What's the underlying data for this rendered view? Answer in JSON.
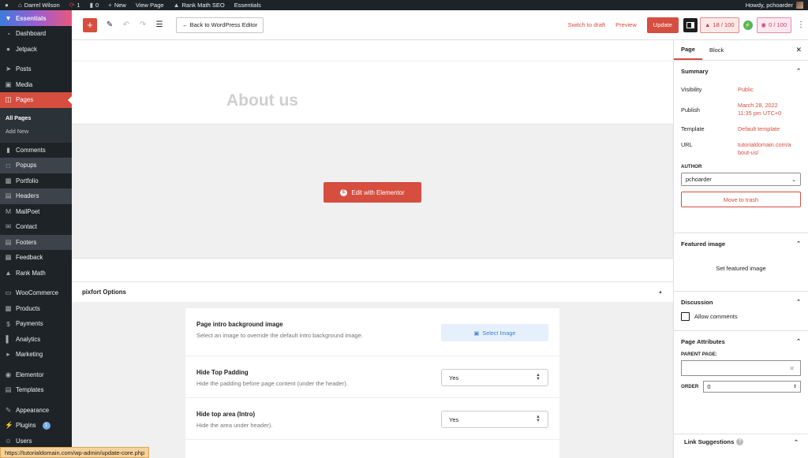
{
  "admin_bar": {
    "site_name": "Darrel Wilson",
    "updates_count": "1",
    "comments_count": "0",
    "new_label": "New",
    "view_page_label": "View Page",
    "rank_math_label": "Rank Math SEO",
    "essentials_label": "Essentials",
    "howdy_label": "Howdy, pchoarder"
  },
  "sidebar": {
    "items": [
      {
        "label": "Essentials",
        "icon": "essentials-icon"
      },
      {
        "label": "Dashboard",
        "icon": "dashboard-icon"
      },
      {
        "label": "Jetpack",
        "icon": "jetpack-icon"
      },
      {
        "label": "Posts",
        "icon": "pin-icon"
      },
      {
        "label": "Media",
        "icon": "media-icon"
      },
      {
        "label": "Pages",
        "icon": "pages-icon"
      },
      {
        "label": "Comments",
        "icon": "comments-icon"
      },
      {
        "label": "Popups",
        "icon": "popups-icon"
      },
      {
        "label": "Portfolio",
        "icon": "portfolio-icon"
      },
      {
        "label": "Headers",
        "icon": "headers-icon"
      },
      {
        "label": "MailPoet",
        "icon": "mailpoet-icon"
      },
      {
        "label": "Contact",
        "icon": "contact-icon"
      },
      {
        "label": "Footers",
        "icon": "footers-icon"
      },
      {
        "label": "Feedback",
        "icon": "feedback-icon"
      },
      {
        "label": "Rank Math",
        "icon": "rank-math-icon"
      },
      {
        "label": "WooCommerce",
        "icon": "woocommerce-icon"
      },
      {
        "label": "Products",
        "icon": "products-icon"
      },
      {
        "label": "Payments",
        "icon": "payments-icon"
      },
      {
        "label": "Analytics",
        "icon": "analytics-icon"
      },
      {
        "label": "Marketing",
        "icon": "marketing-icon"
      },
      {
        "label": "Elementor",
        "icon": "elementor-icon"
      },
      {
        "label": "Templates",
        "icon": "templates-icon"
      },
      {
        "label": "Appearance",
        "icon": "appearance-icon"
      },
      {
        "label": "Plugins",
        "icon": "plugins-icon",
        "badge": "1"
      },
      {
        "label": "Users",
        "icon": "users-icon"
      }
    ],
    "submenu": {
      "all_pages": "All Pages",
      "add_new": "Add New"
    }
  },
  "status_url": "https://tutorialdomain.com/wp-admin/update-core.php",
  "toolbar": {
    "back_label": "← Back to WordPress Editor",
    "switch_draft": "Switch to draft",
    "preview": "Preview",
    "update": "Update",
    "seo_score": "18 / 100",
    "readability_score": "0 / 100"
  },
  "editor": {
    "page_title": "About us",
    "edit_with_elementor": "Edit with Elementor",
    "pixfort_header": "pixfort Options",
    "options": [
      {
        "title": "Page intro background image",
        "desc": "Select an image to override the default intro background image.",
        "control": "Select Image"
      },
      {
        "title": "Hide Top Padding",
        "desc": "Hide the padding before page content (under the header).",
        "control": "Yes"
      },
      {
        "title": "Hide top area (Intro)",
        "desc": "Hide the area under header).",
        "control": "Yes"
      }
    ]
  },
  "panel": {
    "tab_page": "Page",
    "tab_block": "Block",
    "summary": {
      "title": "Summary",
      "visibility_label": "Visibility",
      "visibility_value": "Public",
      "publish_label": "Publish",
      "publish_date": "March 28, 2022",
      "publish_time": "11:35 pm UTC+0",
      "template_label": "Template",
      "template_value": "Default template",
      "url_label": "URL",
      "url_line1": "tutorialdomain.com/a",
      "url_line2": "bout-us/",
      "author_label": "AUTHOR",
      "author_value": "pchoarder",
      "trash_label": "Move to trash"
    },
    "featured": {
      "title": "Featured image",
      "set_label": "Set featured image"
    },
    "discussion": {
      "title": "Discussion",
      "allow_comments": "Allow comments"
    },
    "attributes": {
      "title": "Page Attributes",
      "parent_label": "PARENT PAGE:",
      "order_label": "ORDER",
      "order_value": "0"
    },
    "link_suggestions": "Link Suggestions"
  },
  "colors": {
    "accent": "#d54e3f",
    "admin_bg": "#1d2327"
  }
}
